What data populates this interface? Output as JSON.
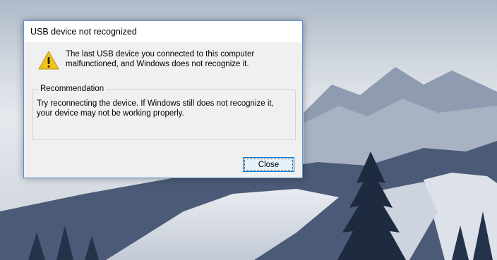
{
  "dialog": {
    "title": "USB device not recognized",
    "message": "The last USB device you connected to this computer malfunctioned, and Windows does not recognize it.",
    "recommendation": {
      "legend": "Recommendation",
      "text": "Try reconnecting the device. If Windows still does not recognize it, your device may not be working properly."
    },
    "close_label": "Close"
  },
  "icons": {
    "warning": "warning-icon"
  },
  "colors": {
    "accent": "#0078d7",
    "dialog_border": "#5b8fd3",
    "warning_fill": "#f4c21a"
  }
}
